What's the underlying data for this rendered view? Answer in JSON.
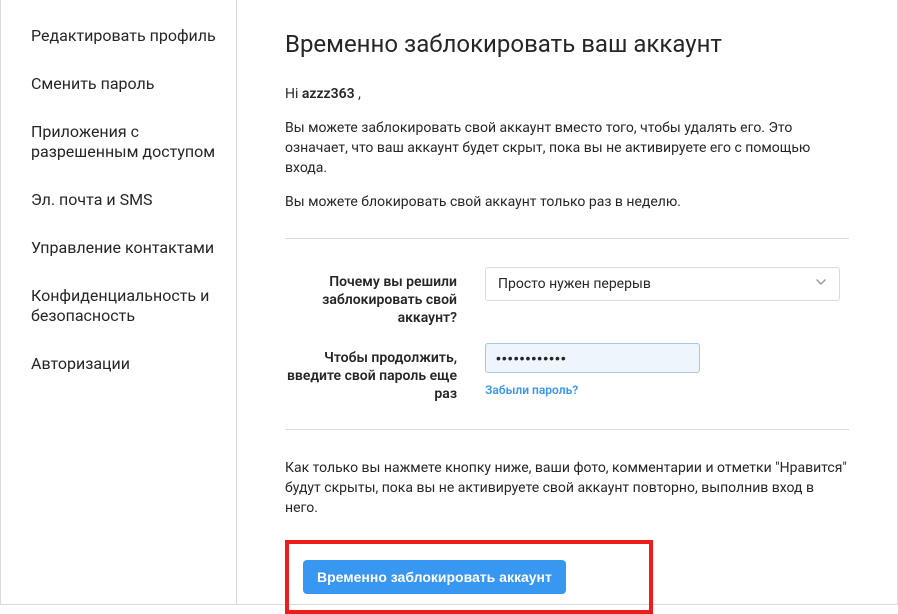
{
  "sidebar": {
    "items": [
      {
        "label": "Редактировать профиль"
      },
      {
        "label": "Сменить пароль"
      },
      {
        "label": "Приложения с разрешенным доступом"
      },
      {
        "label": "Эл. почта и SMS"
      },
      {
        "label": "Управление контактами"
      },
      {
        "label": "Конфиденциальность и безопасность"
      },
      {
        "label": "Авторизации"
      }
    ]
  },
  "main": {
    "title": "Временно заблокировать ваш аккаунт",
    "greeting_prefix": "Hi ",
    "greeting_name": "azzz363",
    "greeting_suffix": " ,",
    "desc1": "Вы можете заблокировать свой аккаунт вместо того, чтобы удалять его. Это означает, что ваш аккаунт будет скрыт, пока вы не активируете его с помощью входа.",
    "desc2": "Вы можете блокировать свой аккаунт только раз в неделю.",
    "reason_label": "Почему вы решили заблокировать свой аккаунт?",
    "reason_value": "Просто нужен перерыв",
    "password_label": "Чтобы продолжить, введите свой пароль еще раз",
    "password_value": "............",
    "forgot_password": "Забыли пароль?",
    "final_note": "Как только вы нажмете кнопку ниже, ваши фото, комментарии и отметки \"Нравится\" будут скрыты, пока вы не активируете свой аккаунт повторно, выполнив вход в него.",
    "button_label": "Временно заблокировать аккаунт"
  }
}
